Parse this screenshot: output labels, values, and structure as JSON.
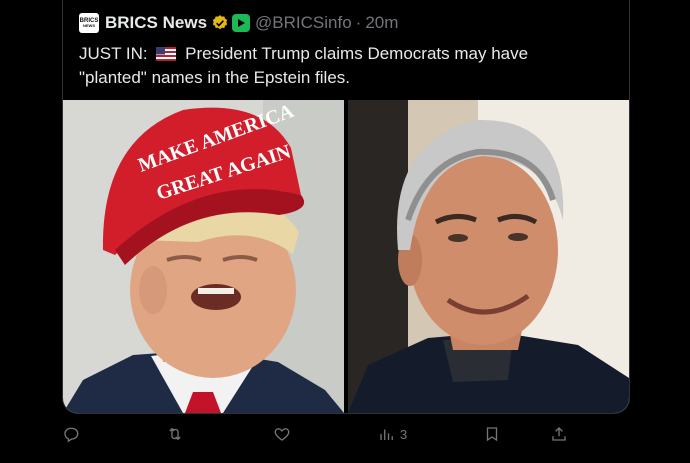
{
  "tweet": {
    "display_name": "BRICS News",
    "handle": "@BRICSinfo",
    "time_sep": "·",
    "time": "20m",
    "logo_line1": "BRICS",
    "logo_line2": "NEWS",
    "text_prefix": "JUST IN:",
    "text_body": "President Trump claims Democrats may have \"planted\" names in the Epstein files.",
    "flag_icon": "us-flag-icon",
    "hat_text_line1": "MAKE AMERICA",
    "hat_text_line2": "GREAT AGAIN"
  },
  "actions": {
    "reply_icon": "reply-icon",
    "retweet_icon": "retweet-icon",
    "like_icon": "heart-icon",
    "views_icon": "views-icon",
    "views_count": "3",
    "bookmark_icon": "bookmark-icon",
    "share_icon": "share-icon"
  },
  "colors": {
    "background": "#000000",
    "text": "#e7e9ea",
    "muted": "#71767b",
    "verified_gold": "#e2b719"
  }
}
